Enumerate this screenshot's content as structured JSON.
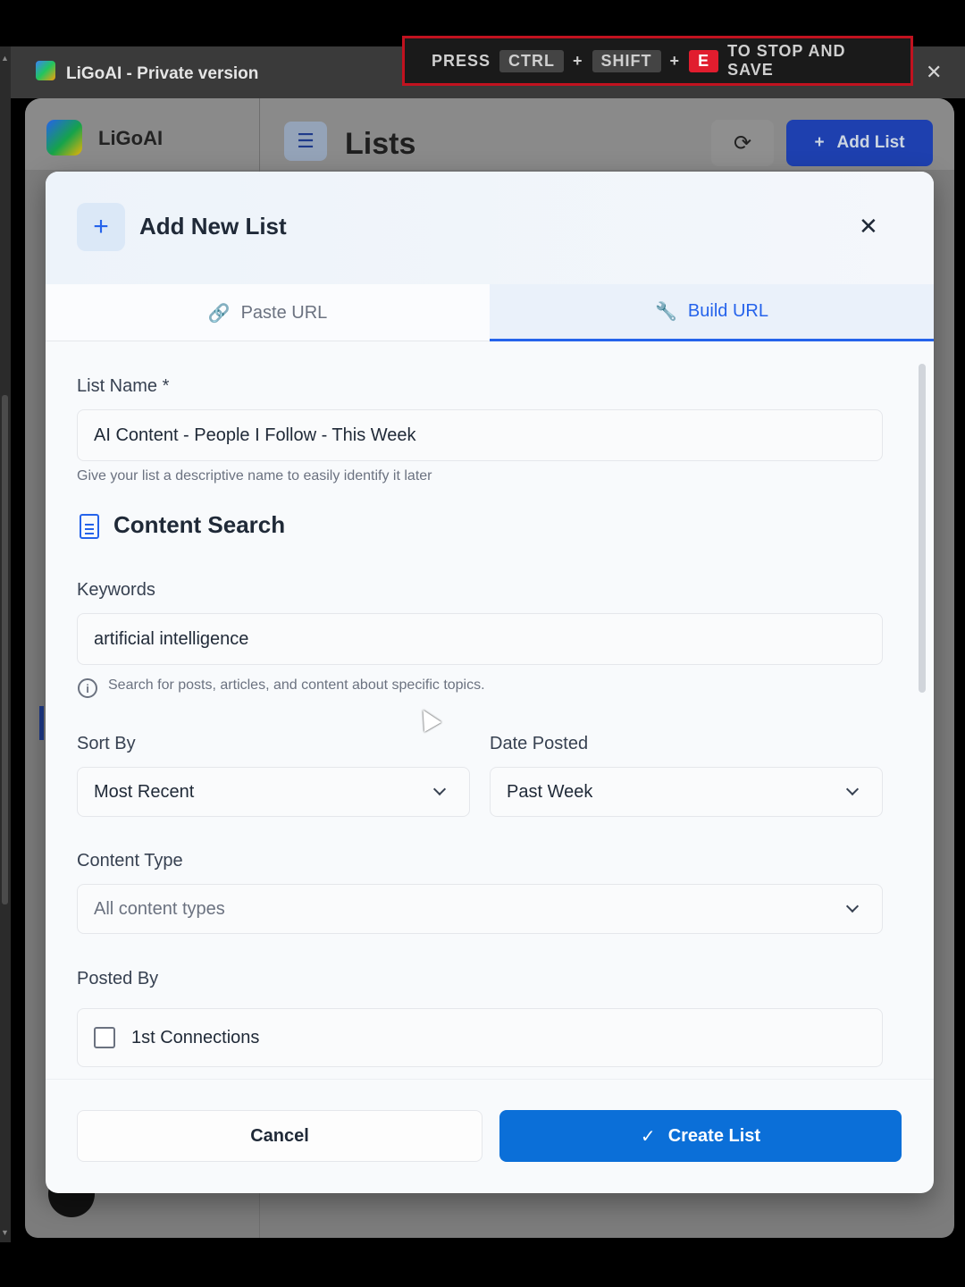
{
  "window": {
    "title": "LiGoAI - Private version",
    "close_glyph": "✕"
  },
  "recorder_banner": {
    "press": "PRESS",
    "ctrl": "CTRL",
    "shift": "SHIFT",
    "key_e": "E",
    "suffix": "TO STOP AND SAVE",
    "plus": "+"
  },
  "app": {
    "name": "LiGoAI",
    "page_title": "Lists",
    "refresh_icon": "refresh-icon",
    "add_list_label": "Add List",
    "add_list_glyph": "+"
  },
  "modal": {
    "title": "Add New List",
    "plus_glyph": "+",
    "close_glyph": "✕",
    "tabs": [
      {
        "label": "Paste URL",
        "icon": "link-icon",
        "glyph": "🔗",
        "active": false
      },
      {
        "label": "Build URL",
        "icon": "wrench-icon",
        "glyph": "🔧",
        "active": true
      }
    ],
    "list_name": {
      "label": "List Name *",
      "value": "AI Content - People I Follow - This Week",
      "helper": "Give your list a descriptive name to easily identify it later"
    },
    "content_search": {
      "title": "Content Search",
      "keywords_label": "Keywords",
      "keywords_value": "artificial intelligence",
      "keywords_helper": "Search for posts, articles, and content about specific topics.",
      "info_glyph": "i"
    },
    "sort_by": {
      "label": "Sort By",
      "value": "Most Recent"
    },
    "date_posted": {
      "label": "Date Posted",
      "value": "Past Week"
    },
    "content_type": {
      "label": "Content Type",
      "placeholder": "All content types"
    },
    "posted_by": {
      "label": "Posted By",
      "option_1": "1st Connections",
      "option_1_checked": false
    },
    "cancel_label": "Cancel",
    "create_label": "Create List",
    "create_glyph": "✓"
  },
  "colors": {
    "accent": "#2563eb",
    "primary_button": "#0b6fd8",
    "recorder_border": "#c1121f"
  }
}
